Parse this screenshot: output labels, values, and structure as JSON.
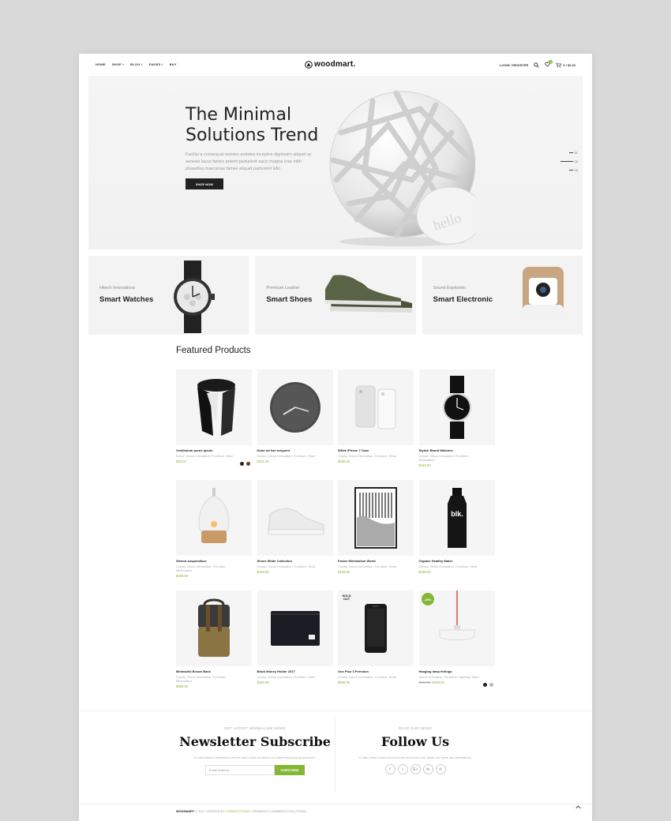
{
  "nav": {
    "items": [
      {
        "label": "HOME",
        "caret": ""
      },
      {
        "label": "SHOP",
        "caret": "▾"
      },
      {
        "label": "BLOG",
        "caret": "▾"
      },
      {
        "label": "PAGES",
        "caret": "▾"
      },
      {
        "label": "BUY",
        "caret": ""
      }
    ]
  },
  "brand": {
    "logo_text": "woodmart.",
    "accent": "#83b735"
  },
  "header": {
    "login_label": "LOGIN / REGISTER",
    "wishlist_count": "0",
    "cart_label": "0 / $0.00"
  },
  "hero": {
    "title": "The Minimal Solutions Trend",
    "text": "Facilisi a consequat montes sodales inceptos dignissim aliquet ac aenean lacus fames petent parturient sacis magna cras nibh phasellus maecenas fames aliquet parturient iidic.",
    "button": "SHOP NOW",
    "slides": [
      "01",
      "02",
      "03"
    ],
    "device_text": "hello"
  },
  "categories": [
    {
      "sub": "Hitech Innovations",
      "title": "Smart Watches"
    },
    {
      "sub": "Premium Leather",
      "title": "Smart Shoes"
    },
    {
      "sub": "Sound Explosion",
      "title": "Smart Electronic"
    }
  ],
  "featured": {
    "title": "Featured Products",
    "products": [
      {
        "name": "Vestibulum purus ipsum",
        "cats": "Decor, Decor innovation, Furniture, Shoe",
        "price": "$45.00",
        "old": "",
        "badge": ""
      },
      {
        "name": "Dolor ad hac torquent",
        "cats": "Clocks, Decor innovation, Furniture, Shoe",
        "price": "$151.00",
        "old": "",
        "badge": ""
      },
      {
        "name": "White iPhone 7 Case",
        "cats": "Clocks, Decor innovation, Furniture, Shoe",
        "price": "$459.00",
        "old": "",
        "badge": ""
      },
      {
        "name": "Stylish Brand Watches",
        "cats": "Clocks, Decor innovation, Furniture, Minimalism",
        "price": "$159.00",
        "old": "",
        "badge": ""
      },
      {
        "name": "Sletera suspendisse",
        "cats": "Clocks, Decor innovation, Furniture, Minimalism",
        "price": "$459.00",
        "old": "",
        "badge": ""
      },
      {
        "name": "Shoes White Collection",
        "cats": "Clocks, Decor innovation, Furniture, Shoe",
        "price": "$159.00",
        "old": "",
        "badge": ""
      },
      {
        "name": "Poster Minimalism World",
        "cats": "Clocks, Decor innovation, Furniture, Shoe",
        "price": "$159.00",
        "old": "",
        "badge": ""
      },
      {
        "name": "Organic Healthy Water",
        "cats": "Clocks, Decor innovation, Furniture, Shoe",
        "price": "$159.00",
        "old": "",
        "badge": ""
      },
      {
        "name": "Minimalist Brown Back",
        "cats": "Clocks, Decor innovation, Furniture, Minimalism",
        "price": "$459.00",
        "old": "",
        "badge": ""
      },
      {
        "name": "Black Money Holder 2017",
        "cats": "Clocks, Decor innovation, Furniture, Shoe",
        "price": "$159.00",
        "old": "",
        "badge": ""
      },
      {
        "name": "One Plus 3 Premium",
        "cats": "Clocks, Decor innovation, Furniture, Shoe",
        "price": "$569.00",
        "old": "",
        "badge": "SOLD OUT"
      },
      {
        "name": "Hanging lamp ferlingo",
        "cats": "Decor innovation, Furniture, Lighting, Shoe",
        "price": "$169.00",
        "old": "$200.00",
        "badge": "-15%"
      }
    ],
    "swatches": {
      "p0": [
        "#222222",
        "#6b3f1e"
      ],
      "p11": [
        "#222222",
        "#bbbbbb"
      ]
    },
    "brand_words": {
      "bottle": "blk."
    }
  },
  "newsletter": {
    "pre": "GET LATEST MINIMALISM NEWS",
    "title": "Newsletter Subscribe",
    "text": "In odio lobes is secured to be the first to find out about our latest news and promotions.",
    "placeholder": "Email Address",
    "button": "SUBSCRIBE"
  },
  "follow": {
    "pre": "READ OUR NEWS",
    "title": "Follow Us",
    "text": "In odio lobes is secured to be the first to find out about our news and promotions.",
    "icons": [
      "f",
      "t",
      "G+",
      "✉",
      "℗"
    ]
  },
  "footer": {
    "brand": "WOODMART",
    "year": " © 2017 CREATED BY ",
    "studio": "XTEMOS STUDIO",
    "tail": ". PREMIUM E-COMMERCE SOLUTIONS."
  }
}
